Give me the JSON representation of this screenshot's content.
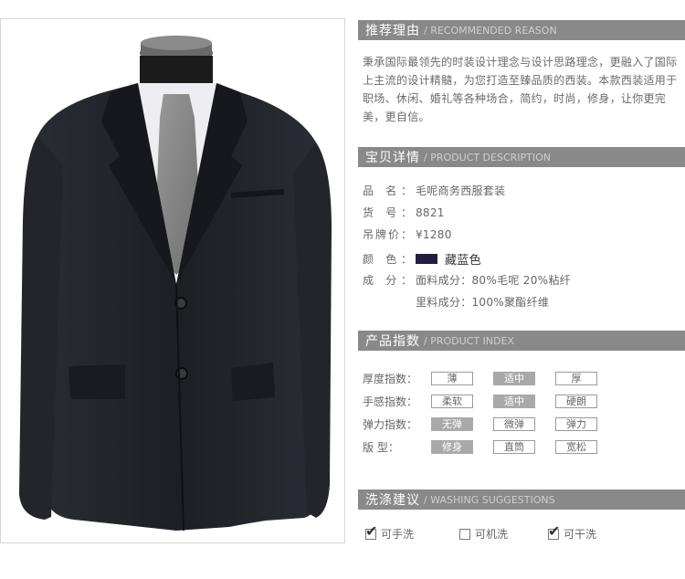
{
  "sections": {
    "reason": {
      "cn": "推荐理由",
      "en": "/ RECOMMENDED REASON"
    },
    "detail": {
      "cn": "宝贝详情",
      "en": "/ PRODUCT DESCRIPTION"
    },
    "index": {
      "cn": "产品指数",
      "en": "/ PRODUCT INDEX"
    },
    "wash": {
      "cn": "洗涤建议",
      "en": "/ WASHING SUGGESTIONS"
    }
  },
  "reason_text": "秉承国际最领先的时装设计理念与设计思路理念，更融入了国际上主流的设计精髓，为您打造至臻品质的西装。本款西装适用于职场、休闲、婚礼等各种场合，简约，时尚，修身，让你更完美，更自信。",
  "details": {
    "name_label": "品 名：",
    "name": "毛呢商务西服套装",
    "sku_label": "货 号：",
    "sku": "8821",
    "price_label": "吊牌价：",
    "price": "¥1280",
    "color_label": "颜 色：",
    "color": "藏蓝色",
    "color_hex": "#1f2040",
    "material_label": "成 分：",
    "material_1": "面料成分：80%毛呢   20%粘纤",
    "material_2": "里料成分：100%聚酯纤维"
  },
  "index": {
    "rows": [
      {
        "label": "厚度指数：",
        "options": [
          "薄",
          "适中",
          "厚"
        ],
        "selected": 1
      },
      {
        "label": "手感指数：",
        "options": [
          "柔软",
          "适中",
          "硬朗"
        ],
        "selected": 1
      },
      {
        "label": "弹力指数：",
        "options": [
          "无弹",
          "微弹",
          "弹力"
        ],
        "selected": 0
      },
      {
        "label": "版    型：",
        "options": [
          "修身",
          "直筒",
          "宽松"
        ],
        "selected": 0
      }
    ]
  },
  "wash": [
    {
      "label": "可手洗",
      "checked": true
    },
    {
      "label": "可机洗",
      "checked": false
    },
    {
      "label": "可干洗",
      "checked": true
    }
  ]
}
